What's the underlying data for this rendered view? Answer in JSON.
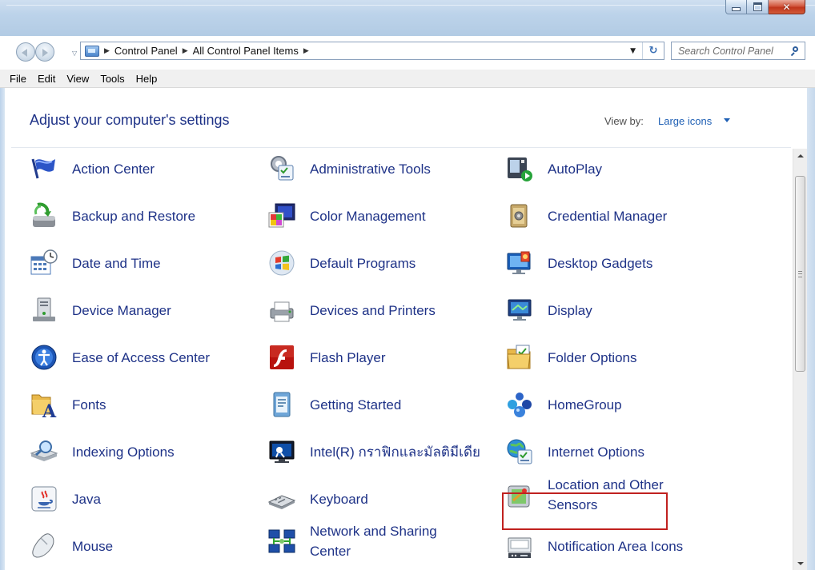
{
  "window": {
    "caption_buttons": [
      "minimize",
      "maximize",
      "close"
    ]
  },
  "address_bar": {
    "breadcrumbs": [
      "Control Panel",
      "All Control Panel Items"
    ],
    "icon": "control-panel-icon"
  },
  "search": {
    "placeholder": "Search Control Panel"
  },
  "menu": [
    "File",
    "Edit",
    "View",
    "Tools",
    "Help"
  ],
  "content": {
    "heading": "Adjust your computer's settings",
    "view_by_label": "View by:",
    "view_by_value": "Large icons"
  },
  "items": [
    {
      "label": "Action Center",
      "icon": "flag-icon"
    },
    {
      "label": "Administrative Tools",
      "icon": "admin-tools-icon"
    },
    {
      "label": "AutoPlay",
      "icon": "autoplay-icon"
    },
    {
      "label": "Backup and Restore",
      "icon": "backup-icon"
    },
    {
      "label": "Color Management",
      "icon": "color-management-icon"
    },
    {
      "label": "Credential Manager",
      "icon": "credential-vault-icon"
    },
    {
      "label": "Date and Time",
      "icon": "calendar-clock-icon"
    },
    {
      "label": "Default Programs",
      "icon": "windows-orb-icon"
    },
    {
      "label": "Desktop Gadgets",
      "icon": "gadgets-icon"
    },
    {
      "label": "Device Manager",
      "icon": "device-manager-icon"
    },
    {
      "label": "Devices and Printers",
      "icon": "printer-icon"
    },
    {
      "label": "Display",
      "icon": "monitor-icon"
    },
    {
      "label": "Ease of Access Center",
      "icon": "ease-of-access-icon"
    },
    {
      "label": "Flash Player",
      "icon": "flash-icon"
    },
    {
      "label": "Folder Options",
      "icon": "folder-options-icon"
    },
    {
      "label": "Fonts",
      "icon": "fonts-folder-icon"
    },
    {
      "label": "Getting Started",
      "icon": "getting-started-icon"
    },
    {
      "label": "HomeGroup",
      "icon": "homegroup-icon"
    },
    {
      "label": "Indexing Options",
      "icon": "indexing-icon"
    },
    {
      "label": "Intel(R) กราฟิกและมัลติมีเดีย",
      "icon": "intel-graphics-icon"
    },
    {
      "label": "Internet Options",
      "icon": "internet-options-icon",
      "highlighted": true
    },
    {
      "label": "Java",
      "icon": "java-icon"
    },
    {
      "label": "Keyboard",
      "icon": "keyboard-icon"
    },
    {
      "label": "Location and Other Sensors",
      "icon": "sensors-icon"
    },
    {
      "label": "Mouse",
      "icon": "mouse-icon"
    },
    {
      "label": "Network and Sharing Center",
      "icon": "network-icon"
    },
    {
      "label": "Notification Area Icons",
      "icon": "notification-icon"
    }
  ],
  "colors": {
    "link": "#1e3287",
    "highlight_border": "#c0211f",
    "accent": "#1e5fb4"
  }
}
